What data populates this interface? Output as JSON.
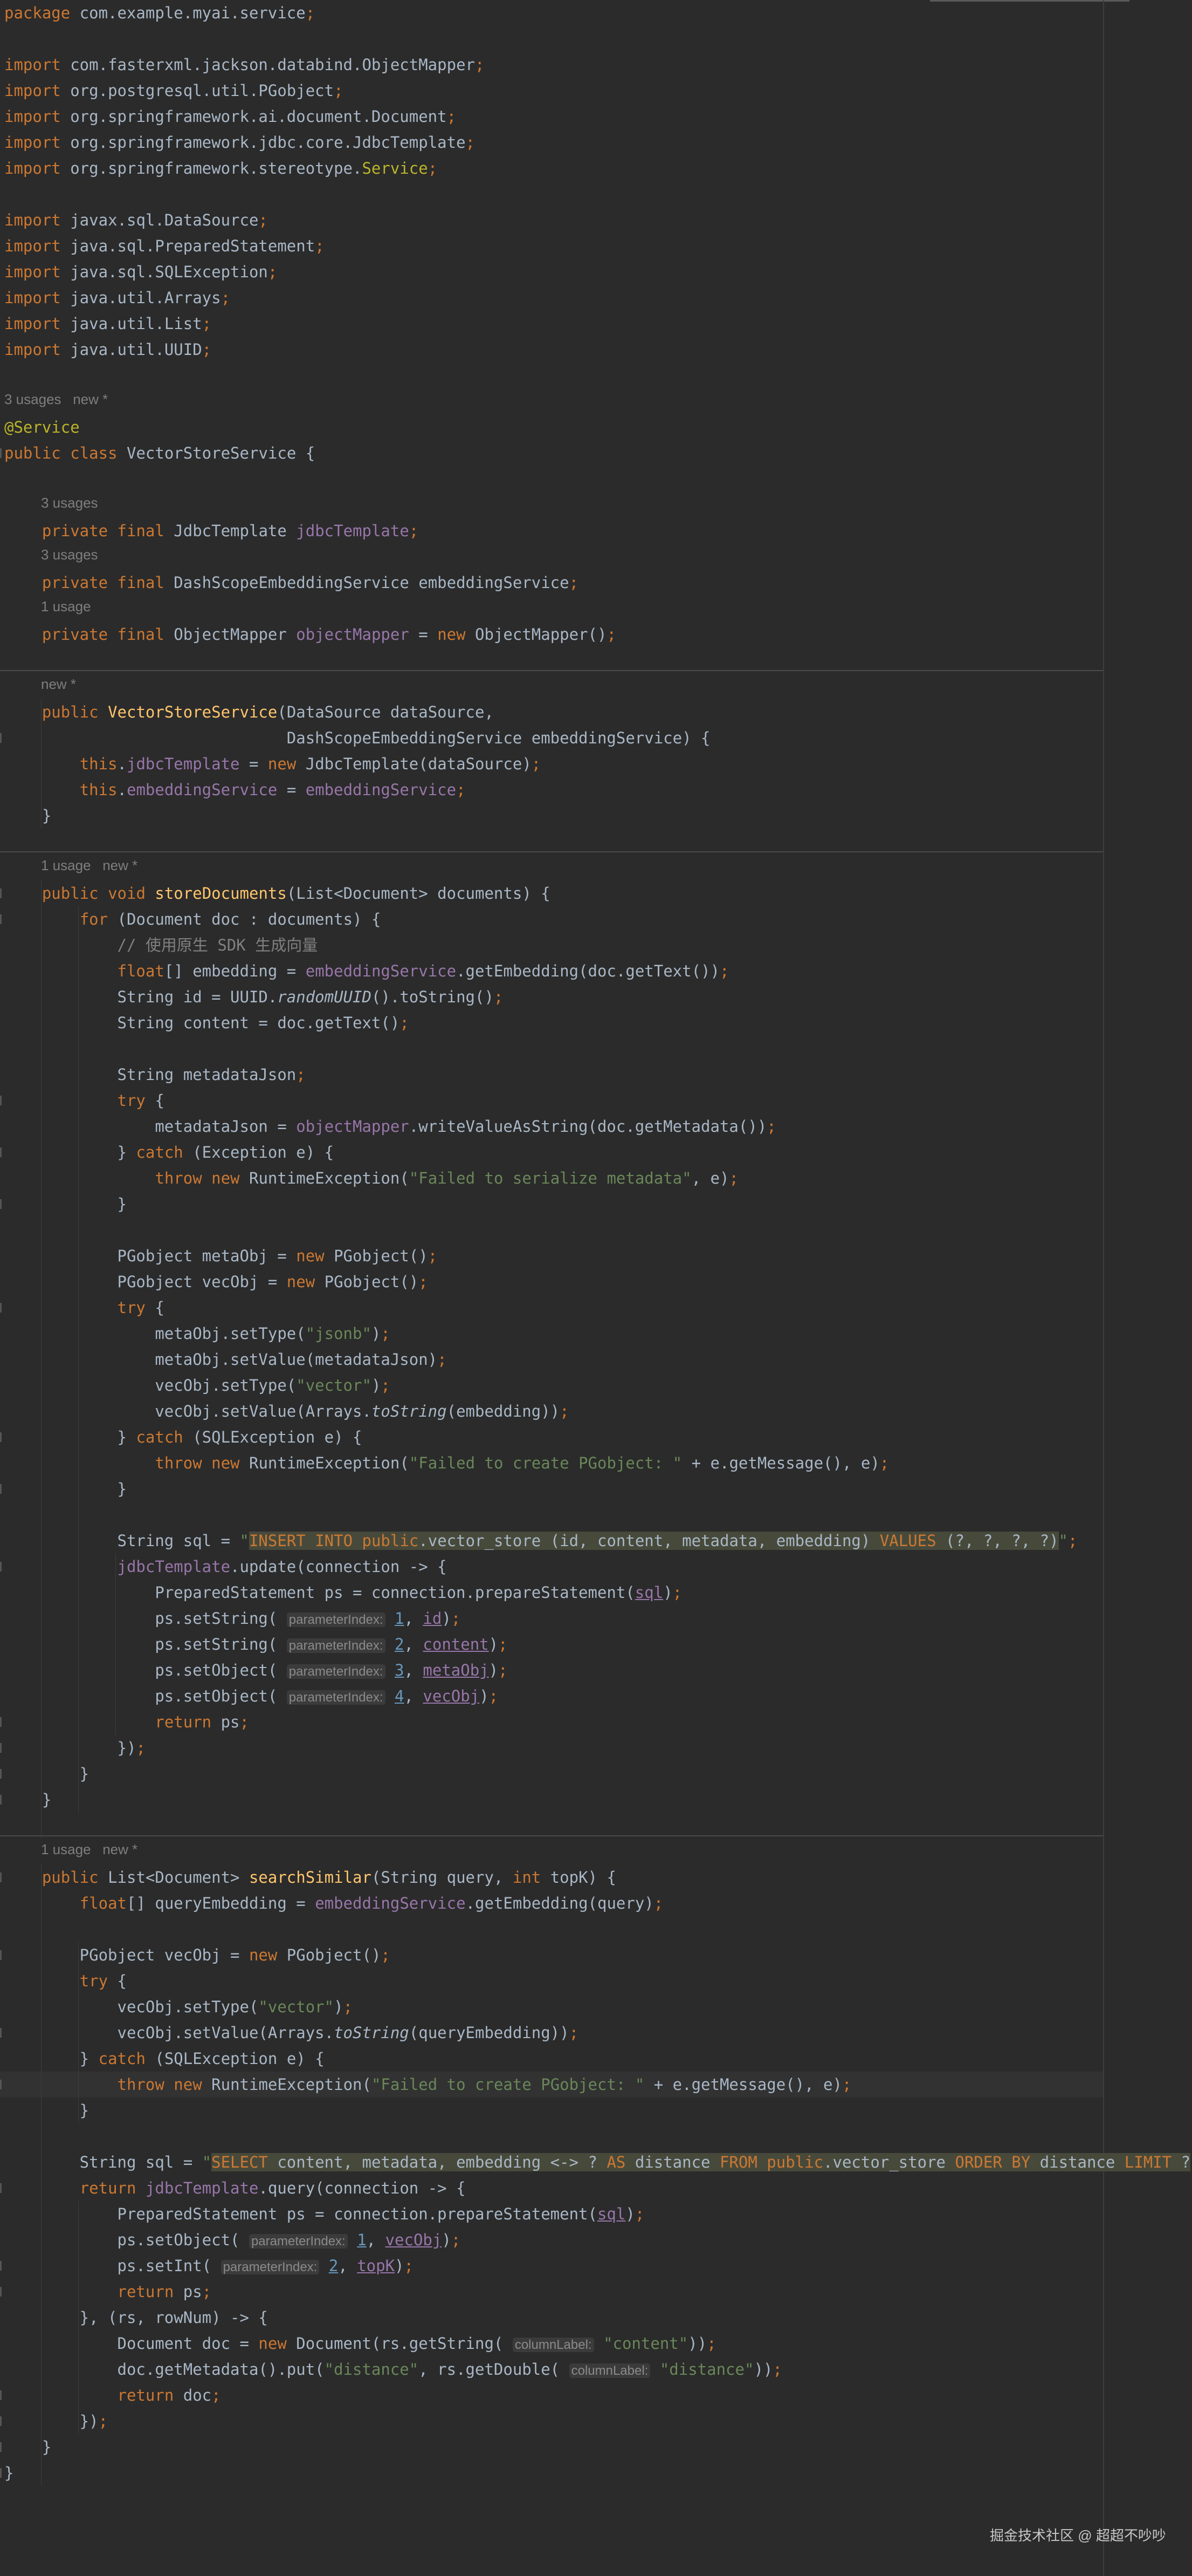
{
  "code_lines": [
    "package com.example.myai.service;",
    "",
    "import com.fasterxml.jackson.databind.ObjectMapper;",
    "import org.postgresql.util.PGobject;",
    "import org.springframework.ai.document.Document;",
    "import org.springframework.jdbc.core.JdbcTemplate;",
    "import org.springframework.stereotype.Service;",
    "",
    "import javax.sql.DataSource;",
    "import java.sql.PreparedStatement;",
    "import java.sql.SQLException;",
    "import java.util.Arrays;",
    "import java.util.List;",
    "import java.util.UUID;",
    "",
    "@Service",
    "public class VectorStoreService {",
    "",
    "    private final JdbcTemplate jdbcTemplate;",
    "    private final DashScopeEmbeddingService embeddingService;",
    "    private final ObjectMapper objectMapper = new ObjectMapper();",
    "",
    "    public VectorStoreService(DataSource dataSource,",
    "                              DashScopeEmbeddingService embeddingService) {",
    "        this.jdbcTemplate = new JdbcTemplate(dataSource);",
    "        this.embeddingService = embeddingService;",
    "    }",
    "",
    "    public void storeDocuments(List<Document> documents) {",
    "        for (Document doc : documents) {",
    "            // 使用原生 SDK 生成向量",
    "            float[] embedding = embeddingService.getEmbedding(doc.getText());",
    "            String id = UUID.randomUUID().toString();",
    "            String content = doc.getText();",
    "",
    "            String metadataJson;",
    "            try {",
    "                metadataJson = objectMapper.writeValueAsString(doc.getMetadata());",
    "            } catch (Exception e) {",
    "                throw new RuntimeException(\"Failed to serialize metadata\", e);",
    "            }",
    "",
    "            PGobject metaObj = new PGobject();",
    "            PGobject vecObj = new PGobject();",
    "            try {",
    "                metaObj.setType(\"jsonb\");",
    "                metaObj.setValue(metadataJson);",
    "                vecObj.setType(\"vector\");",
    "                vecObj.setValue(Arrays.toString(embedding));",
    "            } catch (SQLException e) {",
    "                throw new RuntimeException(\"Failed to create PGobject: \" + e.getMessage(), e);",
    "            }",
    "",
    "            String sql = \"INSERT INTO public.vector_store (id, content, metadata, embedding) VALUES (?, ?, ?, ?)\";",
    "            jdbcTemplate.update(connection -> {",
    "                PreparedStatement ps = connection.prepareStatement(sql);",
    "                ps.setString( parameterIndex: 1, id);",
    "                ps.setString( parameterIndex: 2, content);",
    "                ps.setObject( parameterIndex: 3, metaObj);",
    "                ps.setObject( parameterIndex: 4, vecObj);",
    "                return ps;",
    "            });",
    "        }",
    "    }",
    "",
    "    public List<Document> searchSimilar(String query, int topK) {",
    "        float[] queryEmbedding = embeddingService.getEmbedding(query);",
    "",
    "        PGobject vecObj = new PGobject();",
    "        try {",
    "            vecObj.setType(\"vector\");",
    "            vecObj.setValue(Arrays.toString(queryEmbedding));",
    "        } catch (SQLException e) {",
    "            throw new RuntimeException(\"Failed to create PGobject: \" + e.getMessage(), e);",
    "        }",
    "",
    "        String sql = \"SELECT content, metadata, embedding <-> ? AS distance FROM public.vector_store ORDER BY distance LIMIT ?\";",
    "        return jdbcTemplate.query(connection -> {",
    "            PreparedStatement ps = connection.prepareStatement(sql);",
    "            ps.setObject( parameterIndex: 1, vecObj);",
    "            ps.setInt( parameterIndex: 2, topK);",
    "            return ps;",
    "        }, (rs, rowNum) -> {",
    "            Document doc = new Document(rs.getString( columnLabel: \"content\"));",
    "            doc.getMetadata().put(\"distance\", rs.getDouble( columnLabel: \"distance\"));",
    "            return doc;",
    "        });",
    "    }",
    "}"
  ],
  "usage_hints": [
    "3 usages   new *",
    "3 usages",
    "3 usages",
    "1 usage",
    "new *",
    "1 usage   new *",
    "1 usage   new *"
  ],
  "watermark": "掘金技术社区 @ 超超不吵吵",
  "colors": {
    "background": "#2b2b2b",
    "keyword": "#cc7832",
    "string": "#6a8759",
    "field": "#9876aa",
    "annotation": "#bbb529",
    "method_declaration": "#ffc66d",
    "comment": "#808080",
    "number": "#6897bb",
    "default_text": "#a9b7c6"
  }
}
